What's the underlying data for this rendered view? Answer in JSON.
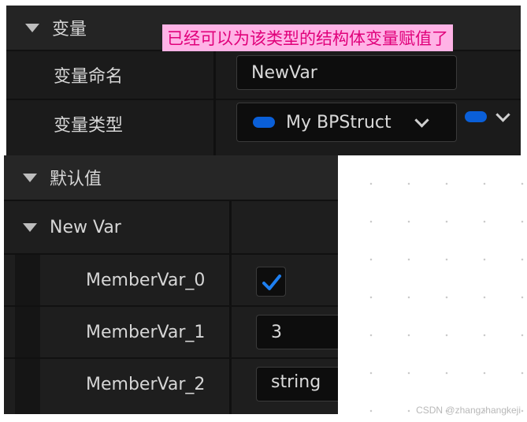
{
  "top_panel": {
    "section_title": "变量",
    "annotation": "已经可以为该类型的结构体变量赋值了",
    "name_label": "变量命名",
    "name_value": "NewVar",
    "type_label": "变量类型",
    "type_value": "My BPStruct",
    "type_icon": "struct-pill-icon",
    "container_icon": "struct-pill-icon"
  },
  "default_panel": {
    "section_title": "默认值",
    "struct_var": "New Var",
    "members": [
      {
        "name": "MemberVar_0",
        "kind": "checkbox",
        "checked": true
      },
      {
        "name": "MemberVar_1",
        "kind": "number",
        "value": "3"
      },
      {
        "name": "MemberVar_2",
        "kind": "text",
        "value": "string"
      }
    ]
  },
  "watermark": "CSDN @zhangzhangkeji",
  "colors": {
    "panel_bg": "#1b1b1b",
    "field_bg": "#0d0d0d",
    "accent_blue": "#0a5fd8",
    "annotation_bg": "#ffb3e6",
    "annotation_text": "#e0007a"
  }
}
